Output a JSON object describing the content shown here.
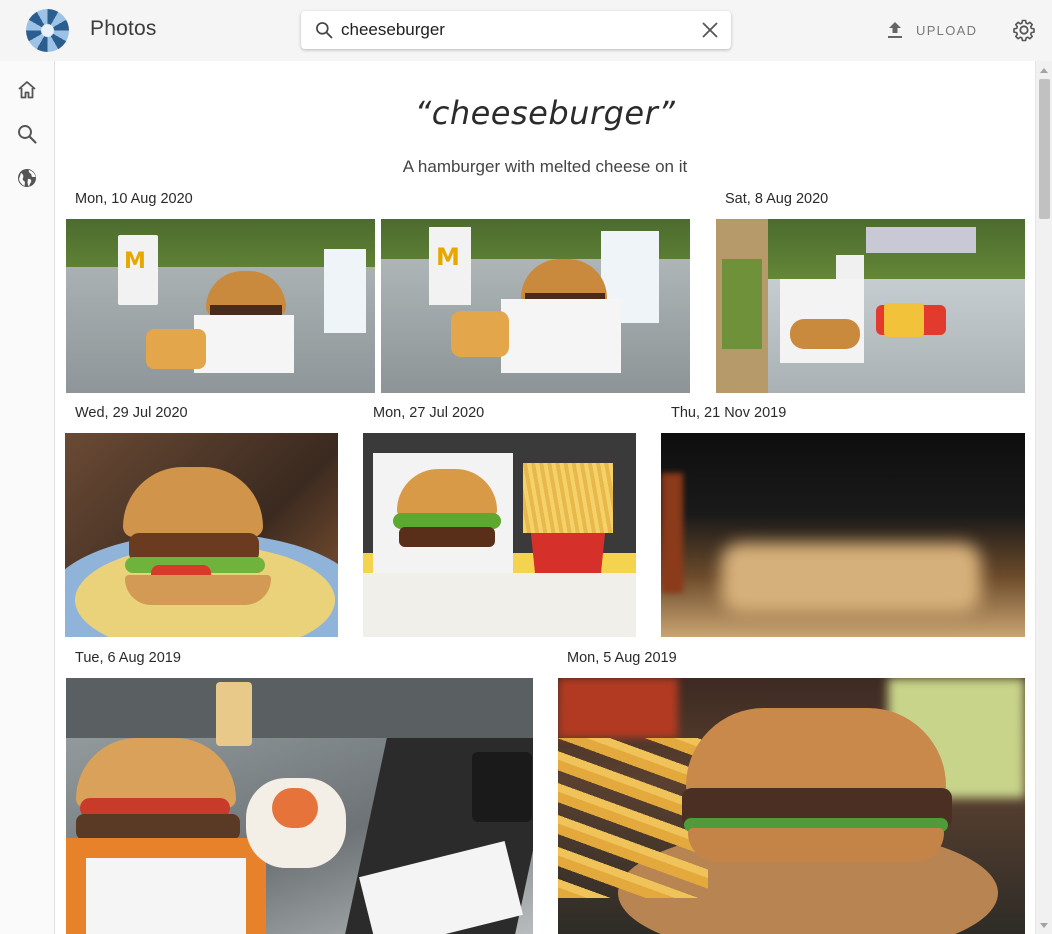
{
  "app": {
    "title": "Photos"
  },
  "search": {
    "value": "cheeseburger",
    "placeholder": ""
  },
  "header": {
    "upload_label": "UPLOAD"
  },
  "rail": {
    "items": [
      {
        "name": "home",
        "icon": "home-icon"
      },
      {
        "name": "search",
        "icon": "search-icon"
      },
      {
        "name": "places",
        "icon": "globe-icon"
      }
    ]
  },
  "results": {
    "query_title": "“cheeseburger”",
    "description": "A hamburger with melted cheese on it",
    "groups": [
      {
        "date": "Mon, 10 Aug 2020"
      },
      {
        "date": "Sat, 8 Aug 2020"
      },
      {
        "date": "Wed, 29 Jul 2020"
      },
      {
        "date": "Mon, 27 Jul 2020"
      },
      {
        "date": "Thu, 21 Nov 2019"
      },
      {
        "date": "Tue, 6 Aug 2019"
      },
      {
        "date": "Mon, 5 Aug 2019"
      }
    ]
  },
  "colors": {
    "topbar": "#f5f5f5",
    "accent_text": "#7a7a7a",
    "content_bg": "#ffffff"
  }
}
